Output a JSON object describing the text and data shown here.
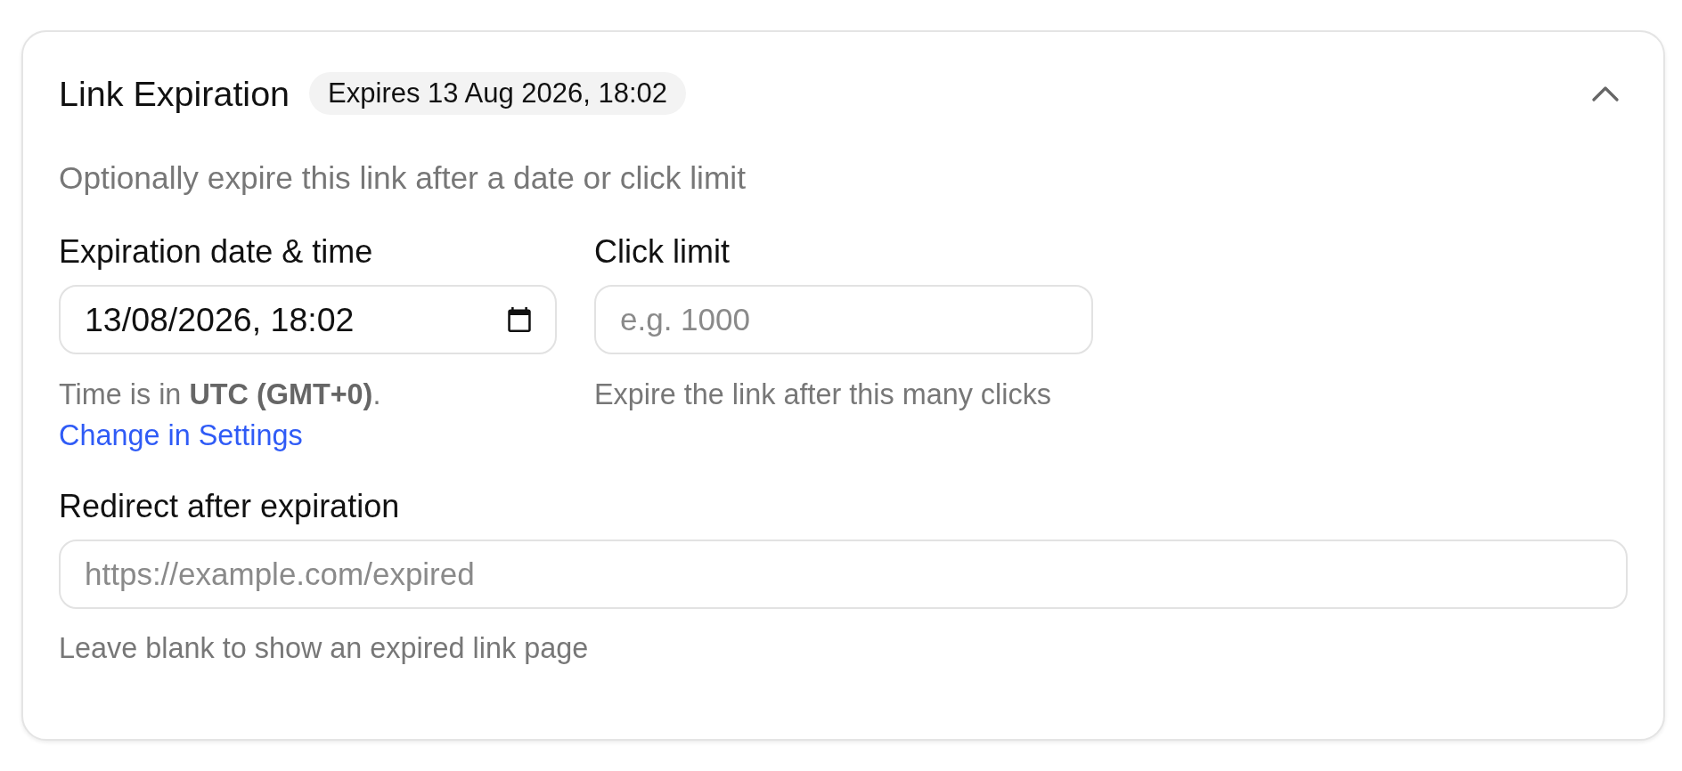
{
  "section": {
    "title": "Link Expiration",
    "badge": "Expires 13 Aug 2026, 18:02",
    "expanded": true,
    "description": "Optionally expire this link after a date or click limit"
  },
  "fields": [
    {
      "kind": "datetime",
      "label": "Expiration date & time",
      "value": "13/08/2026, 18:02",
      "help": "Time is in **UTC (GMT+0)**.",
      "link": "Change in Settings"
    },
    {
      "kind": "number",
      "label": "Click limit",
      "placeholder": "e.g. 1000",
      "help": "Expire the link after this many clicks"
    }
  ],
  "redirect": {
    "label": "Redirect after expiration",
    "placeholder": "https://example.com/expired",
    "help": "Leave blank to show an expired link page"
  }
}
